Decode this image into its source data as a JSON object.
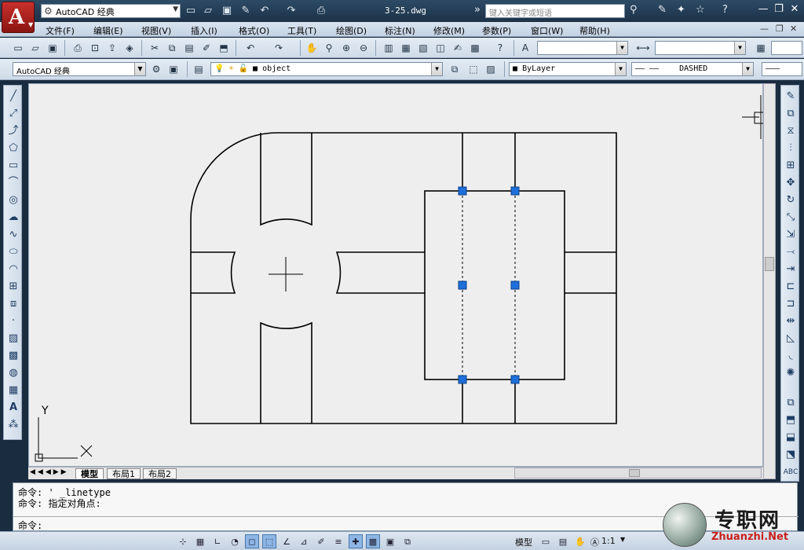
{
  "title_bar": {
    "app_letter": "A",
    "workspace": "AutoCAD 经典",
    "document": "3-25.dwg",
    "search_placeholder": "键入关键字或短语"
  },
  "menu": [
    "文件(F)",
    "编辑(E)",
    "视图(V)",
    "插入(I)",
    "格式(O)",
    "工具(T)",
    "绘图(D)",
    "标注(N)",
    "修改(M)",
    "参数(P)",
    "窗口(W)",
    "帮助(H)"
  ],
  "toolbar": {
    "workspace_combo": "AutoCAD 经典",
    "layer_combo": "object",
    "color_combo": "ByLayer",
    "linetype_combo": "DASHED"
  },
  "layout_tabs": [
    "模型",
    "布局1",
    "布局2"
  ],
  "command": {
    "history": [
      "命令: ' _linetype",
      "命令: 指定对角点:"
    ],
    "prompt": "命令:"
  },
  "status": {
    "model_label": "模型",
    "scale": "1:1"
  },
  "ucs": {
    "x_label": "X",
    "y_label": "Y"
  },
  "watermark": {
    "cn": "专职网",
    "en": "Zhuanzhi.Net"
  }
}
